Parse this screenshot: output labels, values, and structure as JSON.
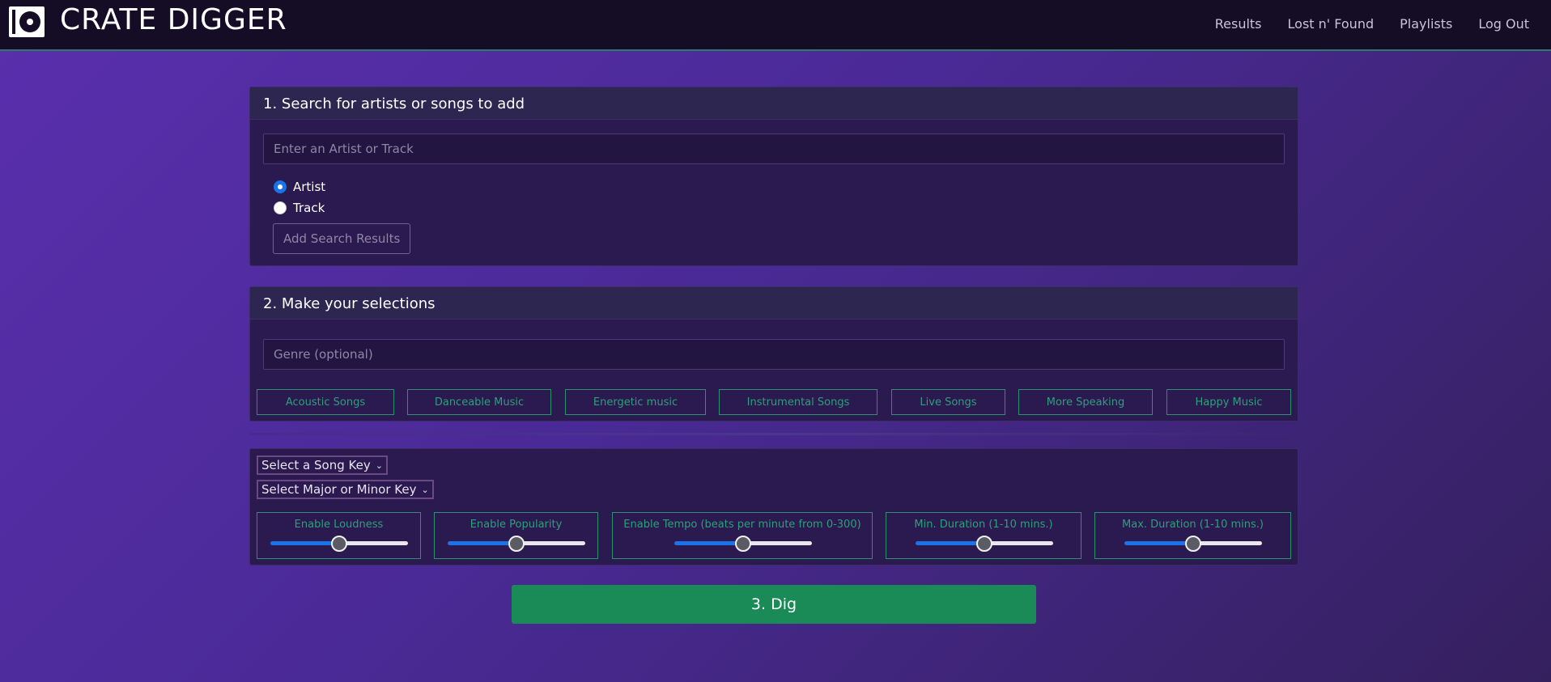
{
  "brand": {
    "name": "CRATE DIGGER",
    "logo_icon": "turntable-icon"
  },
  "nav": [
    "Results",
    "Lost n' Found",
    "Playlists",
    "Log Out"
  ],
  "search_card": {
    "title": "1. Search for artists or songs to add",
    "input_placeholder": "Enter an Artist or Track",
    "radios": [
      {
        "label": "Artist",
        "checked": true
      },
      {
        "label": "Track",
        "checked": false
      }
    ],
    "add_button": "Add Search Results"
  },
  "selection_card": {
    "title": "2. Make your selections",
    "genre_placeholder": "Genre (optional)",
    "moods": [
      "Acoustic Songs",
      "Danceable Music",
      "Energetic music",
      "Instrumental Songs",
      "Live Songs",
      "More Speaking",
      "Happy Music"
    ]
  },
  "advanced_card": {
    "song_key_select": "Select a Song Key",
    "mode_select": "Select Major or Minor Key",
    "sliders": [
      {
        "label": "Enable Loudness",
        "value": 0.5
      },
      {
        "label": "Enable Popularity",
        "value": 0.5
      },
      {
        "label": "Enable Tempo (beats per minute from 0-300)",
        "value": 0.5
      },
      {
        "label": "Min. Duration (1-10 mins.)",
        "value": 0.5
      },
      {
        "label": "Max. Duration (1-10 mins.)",
        "value": 0.5
      }
    ]
  },
  "dig_button": "3. Dig",
  "colors": {
    "accent_green": "#1a8a56",
    "outline_green": "#2f8f72",
    "card_bg": "#2a1a4f"
  }
}
